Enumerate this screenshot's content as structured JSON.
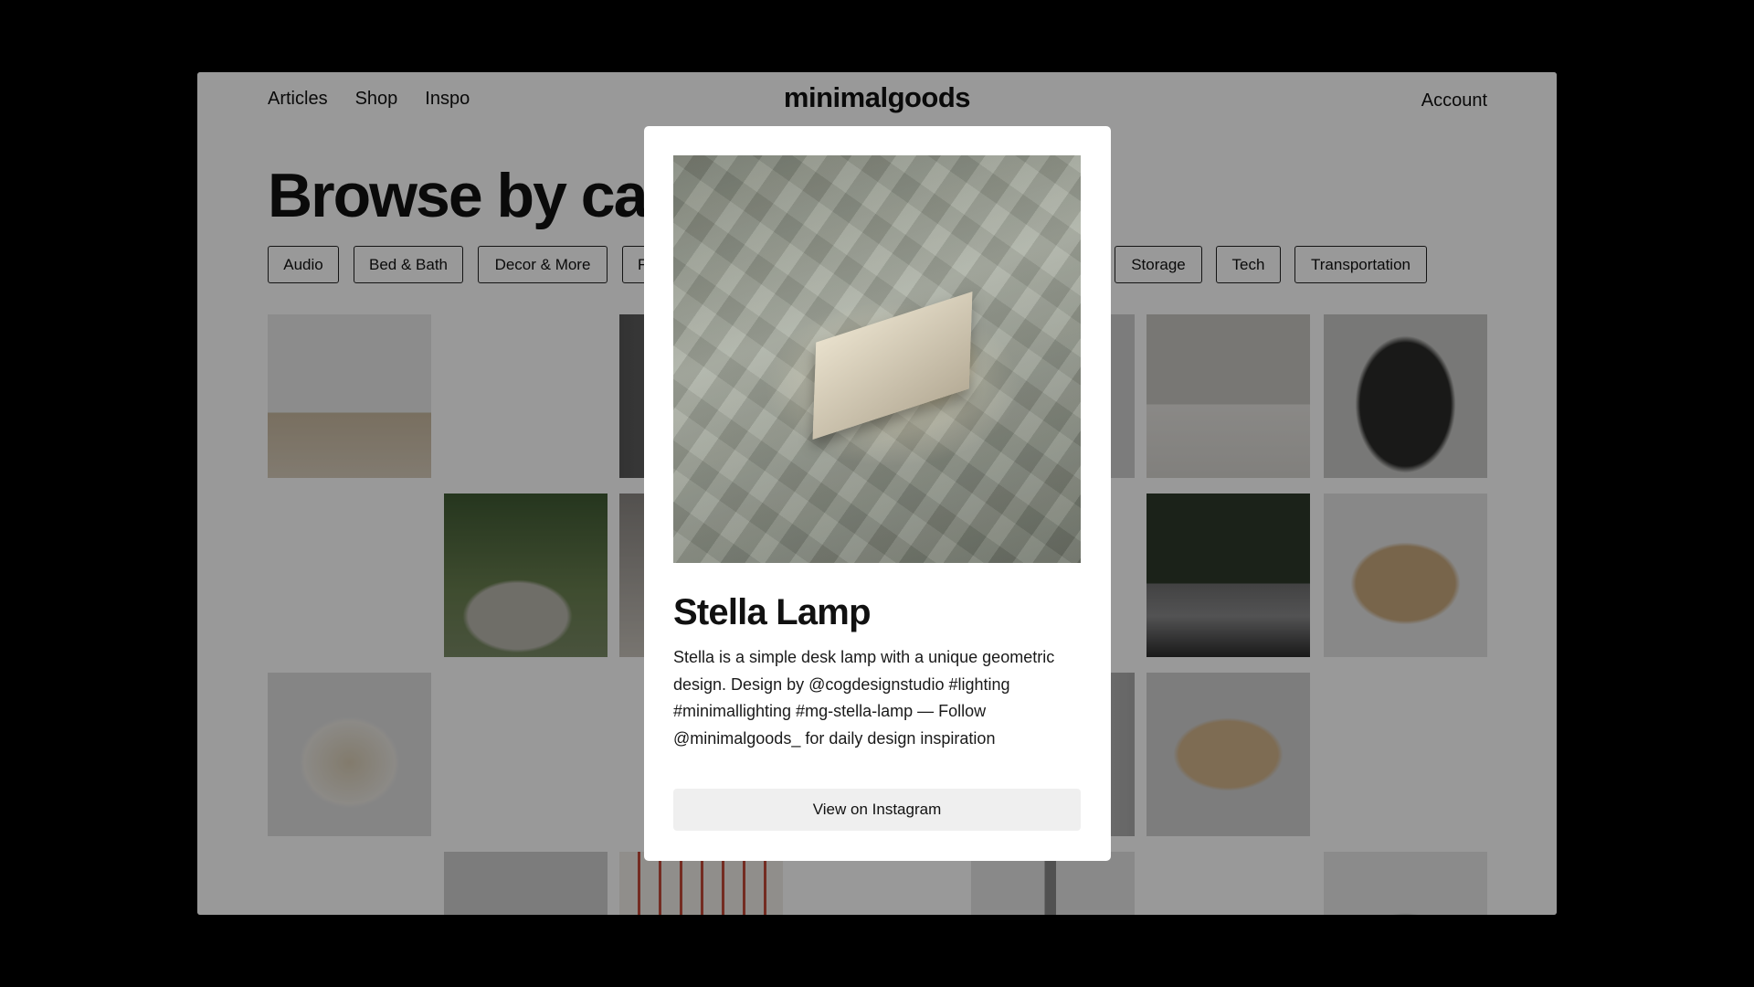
{
  "nav": {
    "links": [
      "Articles",
      "Shop",
      "Inspo"
    ],
    "logo": "minimalgoods",
    "account": "Account"
  },
  "page": {
    "title": "Browse by cat"
  },
  "categories": [
    "Audio",
    "Bed & Bath",
    "Decor & More",
    "F",
    "Storage",
    "Tech",
    "Transportation"
  ],
  "modal": {
    "title": "Stella Lamp",
    "description": "Stella is a simple desk lamp with a unique geometric design. Design by @cogdesignstudio  #lighting #minimallighting #mg-stella-lamp  —  Follow @minimalgoods_ for daily design inspiration",
    "button": "View on Instagram"
  },
  "colors": {
    "overlay": "rgba(0,0,0,0.4)",
    "button_bg": "#efefef"
  }
}
